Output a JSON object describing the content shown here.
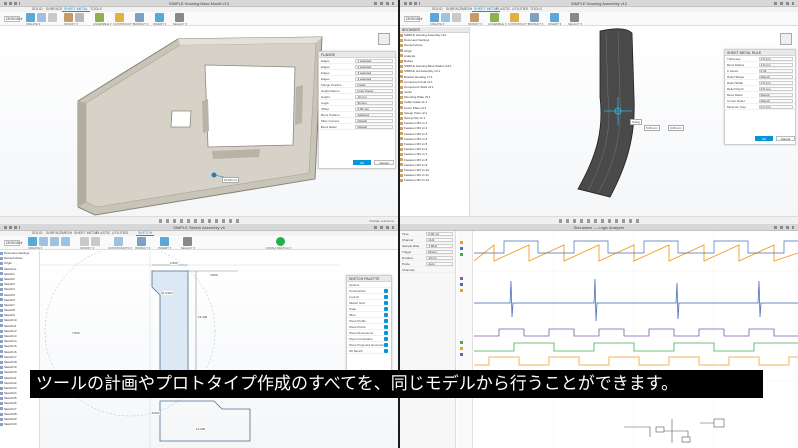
{
  "subtitle": "ツールの計画やプロトタイプ作成のすべてを、同じモデルから行うことができます。",
  "colors": {
    "accent": "#0696d7",
    "ok": "#22b14c",
    "trace_orange": "#f0a020",
    "trace_blue": "#4a6fb5",
    "trace_green": "#3cae5a",
    "trace_purple": "#7a5fb0"
  },
  "q_tl": {
    "window_title": "SIMPLE Housing Base Model v13",
    "tabs": [
      "SOLID",
      "SURFACE",
      "SHEET METAL",
      "TOOLS"
    ],
    "workspace": "DESIGN ▾",
    "groups": [
      "CREATE ▾",
      "MODIFY ▾",
      "ASSEMBLE ▾",
      "CONSTRUCT ▾",
      "INSPECT ▾",
      "INSERT ▾",
      "SELECT ▾"
    ],
    "panel": {
      "title": "FLANGE",
      "rows": [
        {
          "label": "Edges",
          "value": "1 selected"
        },
        {
          "label": "Edges",
          "value": "2 selected"
        },
        {
          "label": "Edges",
          "value": "3 selected"
        },
        {
          "label": "Edges",
          "value": "4 selected"
        },
        {
          "label": "Flange Position",
          "value": "Inside"
        },
        {
          "label": "Height Datum",
          "value": "Inner Faces"
        },
        {
          "label": "Height",
          "value": "10 mm"
        },
        {
          "label": "Angle",
          "value": "90 deg"
        },
        {
          "label": "Offset",
          "value": "0.00 mm"
        },
        {
          "label": "Bend Position",
          "value": "Adjacent"
        },
        {
          "label": "Miter Corners",
          "value": "Default"
        },
        {
          "label": "Bend Relief",
          "value": "Default"
        }
      ],
      "ok": "OK",
      "cancel": "Cancel"
    },
    "dim_tag": "10.00 mm",
    "status": "Multiple selections"
  },
  "q_tr": {
    "window_title": "SIMPLE Housing Assembly v12",
    "tabs": [
      "SOLID",
      "SURFACE",
      "MESH",
      "SHEET METAL",
      "PLASTIC",
      "UTILITIES",
      "TOOLS"
    ],
    "workspace": "DESIGN ▾",
    "groups": [
      "CREATE ▾",
      "MODIFY ▾",
      "ASSEMBLE ▾",
      "CONSTRUCT ▾",
      "INSPECT ▾",
      "INSERT ▾",
      "SELECT ▾"
    ],
    "browser_title": "BROWSER",
    "browser_items": [
      "SIMPLE Housing Assembly v12",
      "Document Settings",
      "Named Views",
      "Origin",
      "Analysis",
      "Bodies",
      "SIMPLE Housing Base Model v13:1",
      "SIMPLE Lid Assembly v4:1",
      "Bracket Housing v7:1",
      "Component Fold v2:1",
      "Component Shell v3:1",
      "Joints",
      "Mounting Plate v5:1",
      "Cable Guide v1:1",
      "Cover Plate v3:1",
      "Sweep Tube v2:1",
      "Spring Clip v1:1",
      "Fastener M3 v1:1",
      "Fastener M3 v1:2",
      "Fastener M3 v1:3",
      "Fastener M3 v1:4",
      "Fastener M3 v1:5",
      "Fastener M3 v1:6",
      "Fastener M3 v1:7",
      "Fastener M3 v1:8",
      "Fastener M3 v1:9",
      "Fastener M3 v1:10",
      "Fastener M3 v1:11",
      "Fastener M3 v1:12"
    ],
    "panel": {
      "title": "SHEET METAL RULE",
      "rows": [
        {
          "label": "Thickness",
          "value": "1.5 mm"
        },
        {
          "label": "Bend Radius",
          "value": "1.5 mm"
        },
        {
          "label": "K Factor",
          "value": "0.44"
        },
        {
          "label": "Relief Shape",
          "value": "Round"
        },
        {
          "label": "Relief Width",
          "value": "1.5 mm"
        },
        {
          "label": "Relief Depth",
          "value": "0.5 mm"
        },
        {
          "label": "Bend Relief",
          "value": "Round"
        },
        {
          "label": "Corner Relief",
          "value": "Round"
        },
        {
          "label": "Minimum Gap",
          "value": "0.1 mm"
        }
      ],
      "ok": "OK",
      "cancel": "Cancel"
    },
    "dim_tags": [
      "5.00 mm",
      "0.00 mm",
      "0 deg"
    ]
  },
  "q_bl": {
    "window_title": "SIMPLE Sketch Assembly v8",
    "tabs": [
      "SOLID",
      "SURFACE",
      "MESH",
      "SHEET METAL",
      "PLASTIC",
      "UTILITIES",
      "SKETCH"
    ],
    "workspace": "DESIGN ▾",
    "groups": [
      "CREATE ▾",
      "MODIFY ▾",
      "CONSTRAINTS ▾",
      "INSPECT ▾",
      "INSERT ▾",
      "SELECT ▾",
      "FINISH SKETCH ▾"
    ],
    "browser_items": [
      "Document Settings",
      "Named Views",
      "Origin",
      "Sketches",
      "Sketch1",
      "Sketch2",
      "Sketch3",
      "Sketch4",
      "Sketch5",
      "Sketch6",
      "Sketch7",
      "Sketch8",
      "Sketch9",
      "Sketch10",
      "Sketch11",
      "Sketch12",
      "Sketch13",
      "Sketch14",
      "Sketch15",
      "Sketch16",
      "Sketch17",
      "Sketch18",
      "Sketch19",
      "Sketch20",
      "Sketch21",
      "Sketch22",
      "Sketch23",
      "Sketch24",
      "Sketch25",
      "Sketch26",
      "Sketch27",
      "Sketch28",
      "Sketch29",
      "Sketch30"
    ],
    "palette": {
      "title": "SKETCH PALETTE",
      "options_title": "Options",
      "rows": [
        "Construction",
        "Look At",
        "Sketch Grid",
        "Snap",
        "Slice",
        "Show Profile",
        "Show Points",
        "Show Dimensions",
        "Show Constraints",
        "Show Projected Geometries",
        "3D Sketch"
      ],
      "finish": "Finish Sketch"
    },
    "dims": [
      "2.503",
      "19.400",
      "7.500",
      "4.500",
      "R 0.500",
      "12.000",
      "8.000"
    ]
  },
  "q_br": {
    "window_title": "Simulation — Logic Analyzer",
    "field_labels": [
      "Time",
      "Channel",
      "Sample Rate",
      "Trigger",
      "Duration",
      "Probe"
    ],
    "field_values": [
      "0.00 ms",
      "CH1",
      "1 MHz",
      "Rising",
      "10 ms",
      "Auto"
    ],
    "section": "Channels"
  }
}
